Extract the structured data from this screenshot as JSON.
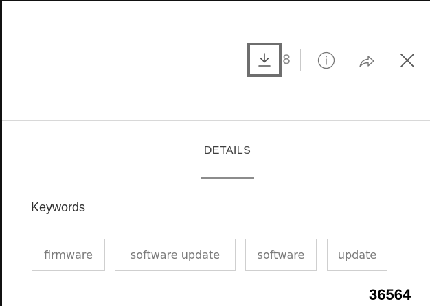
{
  "toolbar": {
    "download_count": "8",
    "icons": {
      "download": "download-icon",
      "info": "info-icon",
      "share": "share-icon",
      "close": "close-icon"
    }
  },
  "tabs": {
    "details_label": "DETAILS"
  },
  "keywords": {
    "heading": "Keywords",
    "items": [
      "firmware",
      "software update",
      "software",
      "update"
    ]
  },
  "figure_number": "36564",
  "colors": {
    "highlight_box": "#6e6e6e",
    "text": "#3c3c3c",
    "chip_border": "#cfcfcf"
  }
}
